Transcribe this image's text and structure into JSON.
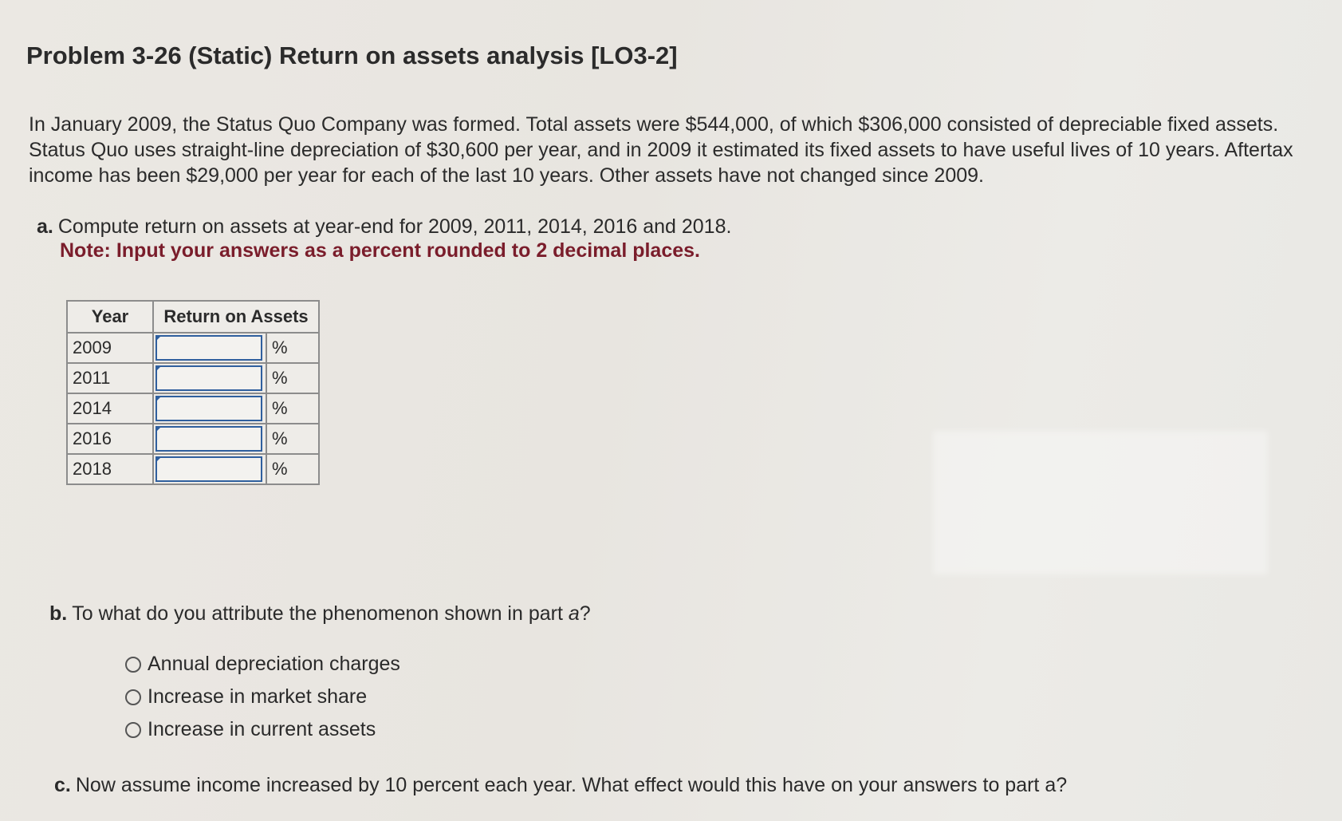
{
  "title": "Problem 3-26 (Static) Return on assets analysis [LO3-2]",
  "intro": "In January 2009, the Status Quo Company was formed. Total assets were $544,000, of which $306,000 consisted of depreciable fixed assets. Status Quo uses straight-line depreciation of $30,600 per year, and in 2009 it estimated its fixed assets to have useful lives of 10 years. Aftertax income has been $29,000 per year for each of the last 10 years. Other assets have not changed since 2009.",
  "part_a": {
    "label": "a.",
    "text": "Compute return on assets at year-end for 2009, 2011, 2014, 2016 and 2018.",
    "note": "Note: Input your answers as a percent rounded to 2 decimal places."
  },
  "table": {
    "headers": [
      "Year",
      "Return on Assets"
    ],
    "unit": "%",
    "rows": [
      {
        "year": "2009",
        "value": ""
      },
      {
        "year": "2011",
        "value": ""
      },
      {
        "year": "2014",
        "value": ""
      },
      {
        "year": "2016",
        "value": ""
      },
      {
        "year": "2018",
        "value": ""
      }
    ]
  },
  "part_b": {
    "label": "b.",
    "text_before": "To what do you attribute the phenomenon shown in part ",
    "text_italic": "a",
    "text_after": "?",
    "options": [
      "Annual depreciation charges",
      "Increase in market share",
      "Increase in current assets"
    ]
  },
  "part_c": {
    "label": "c.",
    "text": "Now assume income increased by 10 percent each year. What effect would this have on your answers to part a?"
  },
  "colors": {
    "note_red": "#7a1d2b",
    "input_border_blue": "#2f5f9e"
  }
}
